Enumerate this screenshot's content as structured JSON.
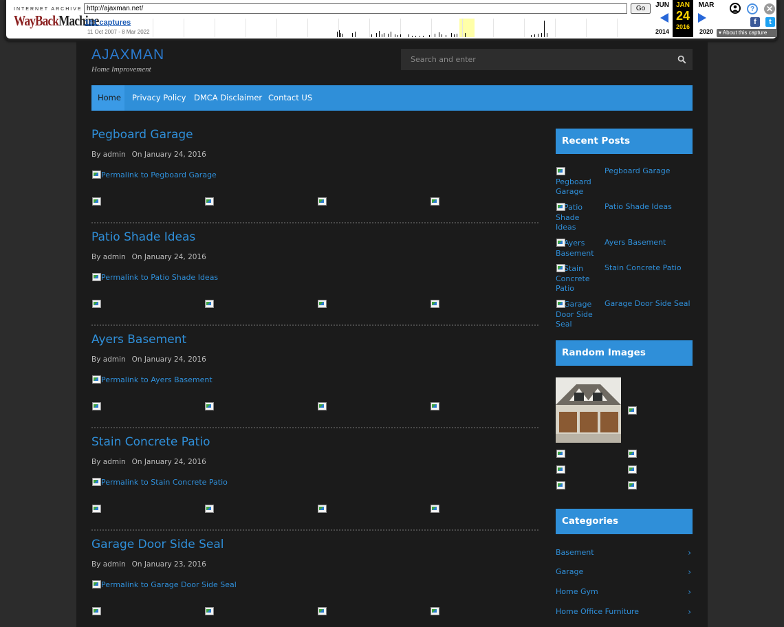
{
  "wayback": {
    "logo_top": "INTERNET ARCHIVE",
    "logo_main_a": "WayBack",
    "logo_main_b": "Machine",
    "url": "http://ajaxman.net/",
    "go_label": "Go",
    "captures": "161 captures",
    "range": "11 Oct 2007 - 8 Mar 2022",
    "prev_month": "JUN",
    "prev_year": "2014",
    "cur_month": "JAN",
    "cur_day": "24",
    "cur_year": "2016",
    "next_month": "MAR",
    "next_year": "2020",
    "about_label": "About this capture"
  },
  "site": {
    "brand": "AJAXMAN",
    "tagline": "Home Improvement",
    "search_placeholder": "Search and enter",
    "nav": [
      "Home",
      "Privacy Policy",
      "DMCA Disclaimer",
      "Contact US"
    ]
  },
  "posts": [
    {
      "title": "Pegboard Garage",
      "author": "By admin",
      "date": "On January 24, 2016",
      "permalink": "Permalink to Pegboard Garage"
    },
    {
      "title": "Patio Shade Ideas",
      "author": "By admin",
      "date": "On January 24, 2016",
      "permalink": "Permalink to Patio Shade Ideas"
    },
    {
      "title": "Ayers Basement",
      "author": "By admin",
      "date": "On January 24, 2016",
      "permalink": "Permalink to Ayers Basement"
    },
    {
      "title": "Stain Concrete Patio",
      "author": "By admin",
      "date": "On January 24, 2016",
      "permalink": "Permalink to Stain Concrete Patio"
    },
    {
      "title": "Garage Door Side Seal",
      "author": "By admin",
      "date": "On January 23, 2016",
      "permalink": "Permalink to Garage Door Side Seal"
    }
  ],
  "sidebar": {
    "recent_title": "Recent Posts",
    "recent": [
      {
        "alt": "Pegboard Garage",
        "link": "Pegboard Garage"
      },
      {
        "alt": "Patio Shade Ideas",
        "link": "Patio Shade Ideas"
      },
      {
        "alt": "Ayers Basement",
        "link": "Ayers Basement"
      },
      {
        "alt": "Stain Concrete Patio",
        "link": "Stain Concrete Patio"
      },
      {
        "alt": "Garage Door Side Seal",
        "link": "Garage Door Side Seal"
      }
    ],
    "random_title": "Random Images",
    "categories_title": "Categories",
    "categories": [
      "Basement",
      "Garage",
      "Home Gym",
      "Home Office Furniture"
    ]
  },
  "colors": {
    "accent": "#2f8fd9",
    "background": "#1b1b1b",
    "outer": "#2c2c2c"
  }
}
